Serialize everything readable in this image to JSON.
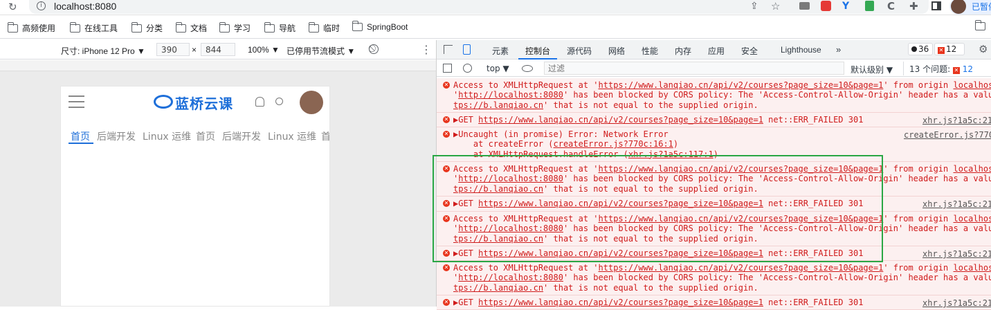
{
  "browser": {
    "url": "localhost:8080",
    "profile_label": "已暂停"
  },
  "bookmarks": [
    "高频使用",
    "在线工具",
    "分类",
    "文档",
    "学习",
    "导航",
    "临时",
    "SpringBoot"
  ],
  "device_toolbar": {
    "device_label": "尺寸: iPhone 12 Pro ▼",
    "width": "390",
    "height": "844",
    "times": "×",
    "zoom": "100% ▼",
    "throttle": "已停用节流模式 ▼"
  },
  "mobile_page": {
    "brand": "蓝桥云课",
    "tabs": [
      "首页",
      "后端开发",
      "Linux 运维",
      "首页",
      "后端开发",
      "Linux 运维",
      "首"
    ]
  },
  "devtools": {
    "tabs": [
      "元素",
      "控制台",
      "源代码",
      "网络",
      "性能",
      "内存",
      "应用",
      "安全",
      "Lighthouse",
      "»"
    ],
    "active_tab": "控制台",
    "warn_count": "36",
    "error_count": "12",
    "context": "top ▼",
    "filter_placeholder": "过滤",
    "level": "默认级别 ▼",
    "issues_label": "13 个问题:",
    "issues_count": "12"
  },
  "console": [
    {
      "type": "cors",
      "l1a": "Access to XMLHttpRequest at '",
      "l1url": "https://www.lanqiao.cn/api/v2/courses?page_size=10&page=1",
      "l1b": "' from origin ",
      "l1origin": "localhos",
      "l2a": "'",
      "l2url": "http://localhost:8080",
      "l2b": "' has been blocked by CORS policy: The 'Access-Control-Allow-Origin' header has a valu",
      "l3url": "tps://b.lanqiao.cn",
      "l3b": "' that is not equal to the supplied origin."
    },
    {
      "type": "get",
      "pre": "▶GET ",
      "url": "https://www.lanqiao.cn/api/v2/courses?page_size=10&page=1",
      "post": " net::ERR_FAILED 301",
      "src": "xhr.js?1a5c:21"
    },
    {
      "type": "uncaught",
      "l1": "▶Uncaught (in promise) Error: Network Error",
      "src": "createError.js?770",
      "l2a": "    at createError (",
      "l2link": "createError.js?770c:16:1",
      "l2b": ")",
      "l3a": "    at XMLHttpRequest.handleError (",
      "l3link": "xhr.js?1a5c:117:1",
      "l3b": ")"
    },
    {
      "type": "cors",
      "l1a": "Access to XMLHttpRequest at '",
      "l1url": "https://www.lanqiao.cn/api/v2/courses?page_size=10&page=1",
      "l1b": "' from origin ",
      "l1origin": "localhos",
      "l2a": "'",
      "l2url": "http://localhost:8080",
      "l2b": "' has been blocked by CORS policy: The 'Access-Control-Allow-Origin' header has a valu",
      "l3url": "tps://b.lanqiao.cn",
      "l3b": "' that is not equal to the supplied origin."
    },
    {
      "type": "get",
      "pre": "▶GET ",
      "url": "https://www.lanqiao.cn/api/v2/courses?page_size=10&page=1",
      "post": " net::ERR_FAILED 301",
      "src": "xhr.js?1a5c:21"
    },
    {
      "type": "cors",
      "l1a": "Access to XMLHttpRequest at '",
      "l1url": "https://www.lanqiao.cn/api/v2/courses?page_size=10&page=1",
      "l1b": "' from origin ",
      "l1origin": "localhos",
      "l2a": "'",
      "l2url": "http://localhost:8080",
      "l2b": "' has been blocked by CORS policy: The 'Access-Control-Allow-Origin' header has a valu",
      "l3url": "tps://b.lanqiao.cn",
      "l3b": "' that is not equal to the supplied origin."
    },
    {
      "type": "get",
      "pre": "▶GET ",
      "url": "https://www.lanqiao.cn/api/v2/courses?page_size=10&page=1",
      "post": " net::ERR_FAILED 301",
      "src": "xhr.js?1a5c:21"
    },
    {
      "type": "cors",
      "l1a": "Access to XMLHttpRequest at '",
      "l1url": "https://www.lanqiao.cn/api/v2/courses?page_size=10&page=1",
      "l1b": "' from origin ",
      "l1origin": "localhos",
      "l2a": "'",
      "l2url": "http://localhost:8080",
      "l2b": "' has been blocked by CORS policy: The 'Access-Control-Allow-Origin' header has a valu",
      "l3url": "tps://b.lanqiao.cn",
      "l3b": "' that is not equal to the supplied origin."
    },
    {
      "type": "get",
      "pre": "▶GET ",
      "url": "https://www.lanqiao.cn/api/v2/courses?page_size=10&page=1",
      "post": " net::ERR_FAILED 301",
      "src": "xhr.js?1a5c:21"
    }
  ],
  "colors": {
    "error_text": "#d01b1b",
    "error_bg": "#fcf0f0",
    "highlight": "#2aa745",
    "accent": "#1a73e8",
    "brand": "#1e6fd9"
  }
}
